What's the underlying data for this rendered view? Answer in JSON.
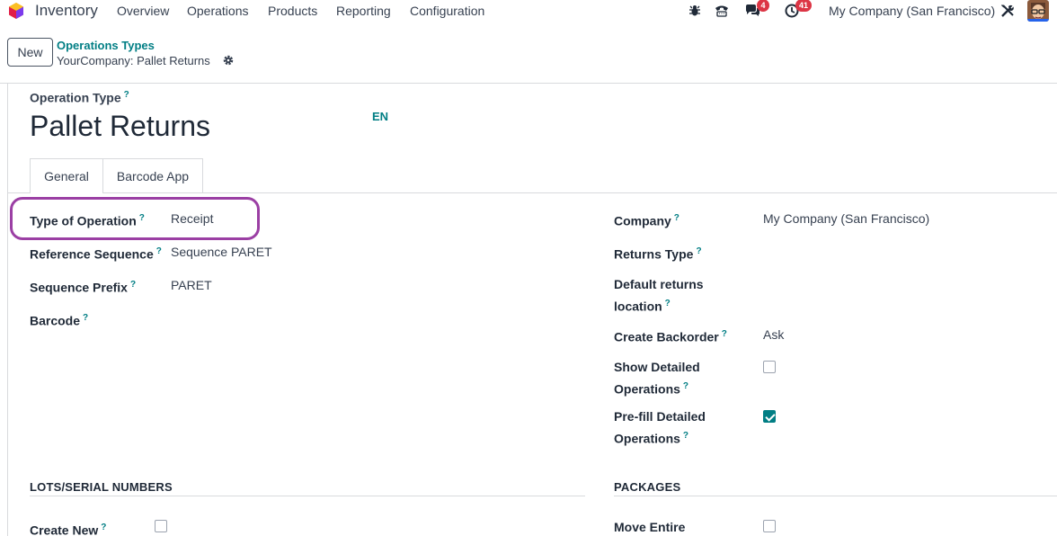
{
  "navbar": {
    "app_name": "Inventory",
    "menus": [
      "Overview",
      "Operations",
      "Products",
      "Reporting",
      "Configuration"
    ],
    "messages_count": "4",
    "activities_count": "41",
    "company": "My Company (San Francisco)"
  },
  "control_panel": {
    "new_label": "New",
    "breadcrumb_parent": "Operations Types",
    "breadcrumb_current": "YourCompany: Pallet Returns"
  },
  "form": {
    "title_label": "Operation Type",
    "title_value": "Pallet Returns",
    "lang": "EN",
    "tabs": [
      "General",
      "Barcode App"
    ],
    "left_fields": {
      "type_of_operation": {
        "label": "Type of Operation",
        "value": "Receipt"
      },
      "reference_sequence": {
        "label": "Reference Sequence",
        "value": "Sequence PARET"
      },
      "sequence_prefix": {
        "label": "Sequence Prefix",
        "value": "PARET"
      },
      "barcode": {
        "label": "Barcode",
        "value": ""
      }
    },
    "right_fields": {
      "company": {
        "label": "Company",
        "value": "My Company (San Francisco)"
      },
      "returns_type": {
        "label": "Returns Type",
        "value": ""
      },
      "default_returns_location": {
        "label_line1": "Default returns",
        "label_line2": "location",
        "value": ""
      },
      "create_backorder": {
        "label": "Create Backorder",
        "value": "Ask"
      },
      "show_detailed_operations": {
        "label_line1": "Show Detailed",
        "label_line2": "Operations",
        "checked": false
      },
      "prefill_detailed_operations": {
        "label_line1": "Pre-fill Detailed",
        "label_line2": "Operations",
        "checked": true
      }
    },
    "sections": {
      "lots": {
        "title": "LOTS/SERIAL NUMBERS",
        "create_new_label": "Create New",
        "create_new_checked": false
      },
      "packages": {
        "title": "PACKAGES",
        "move_entire_label": "Move Entire",
        "move_entire_checked": false
      }
    }
  },
  "colors": {
    "accent": "#017e84",
    "highlight": "#9b3fa4",
    "badge": "#dc3545"
  }
}
